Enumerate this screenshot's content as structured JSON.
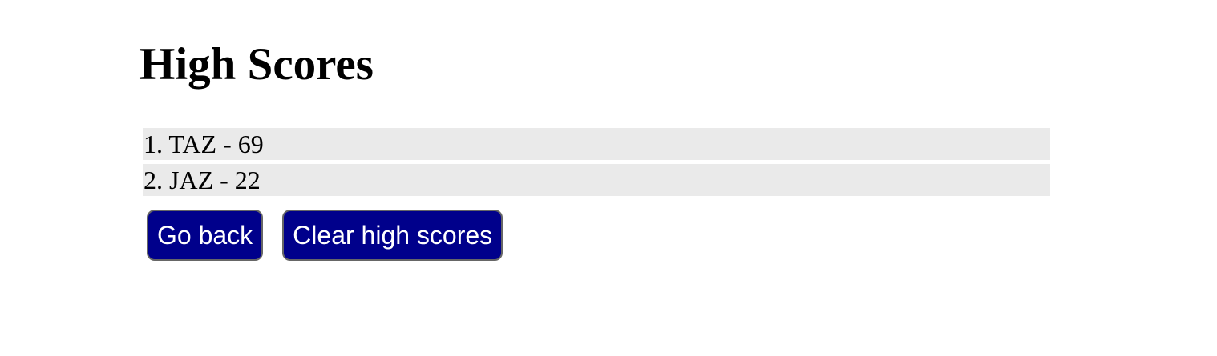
{
  "title": "High Scores",
  "scores": [
    "1. TAZ - 69",
    "2. JAZ - 22"
  ],
  "buttons": {
    "go_back": "Go back",
    "clear": "Clear high scores"
  },
  "colors": {
    "button_bg": "#00008b",
    "row_bg": "#eaeaea"
  }
}
